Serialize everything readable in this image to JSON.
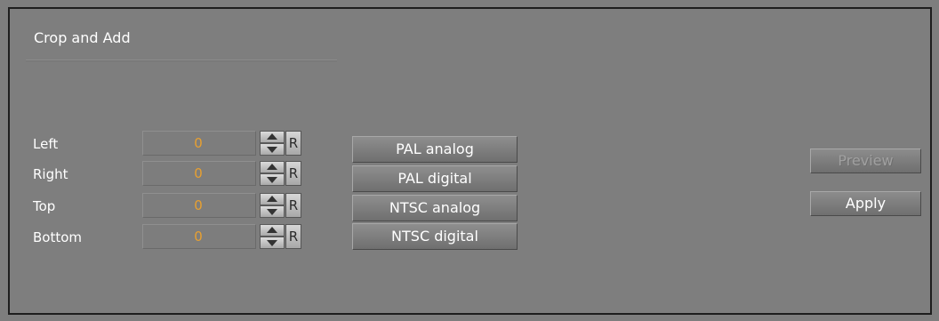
{
  "panel": {
    "title": "Crop and Add"
  },
  "crop": {
    "rows": [
      {
        "label": "Left",
        "value": "0",
        "reset_label": "R"
      },
      {
        "label": "Right",
        "value": "0",
        "reset_label": "R"
      },
      {
        "label": "Top",
        "value": "0",
        "reset_label": "R"
      },
      {
        "label": "Bottom",
        "value": "0",
        "reset_label": "R"
      }
    ]
  },
  "presets": [
    {
      "label": "PAL analog"
    },
    {
      "label": "PAL digital"
    },
    {
      "label": "NTSC analog"
    },
    {
      "label": "NTSC digital"
    }
  ],
  "actions": {
    "preview_label": "Preview",
    "apply_label": "Apply"
  },
  "colors": {
    "background": "#7e7e7e",
    "value_text": "#e8a030",
    "border": "#1e1e1e"
  }
}
